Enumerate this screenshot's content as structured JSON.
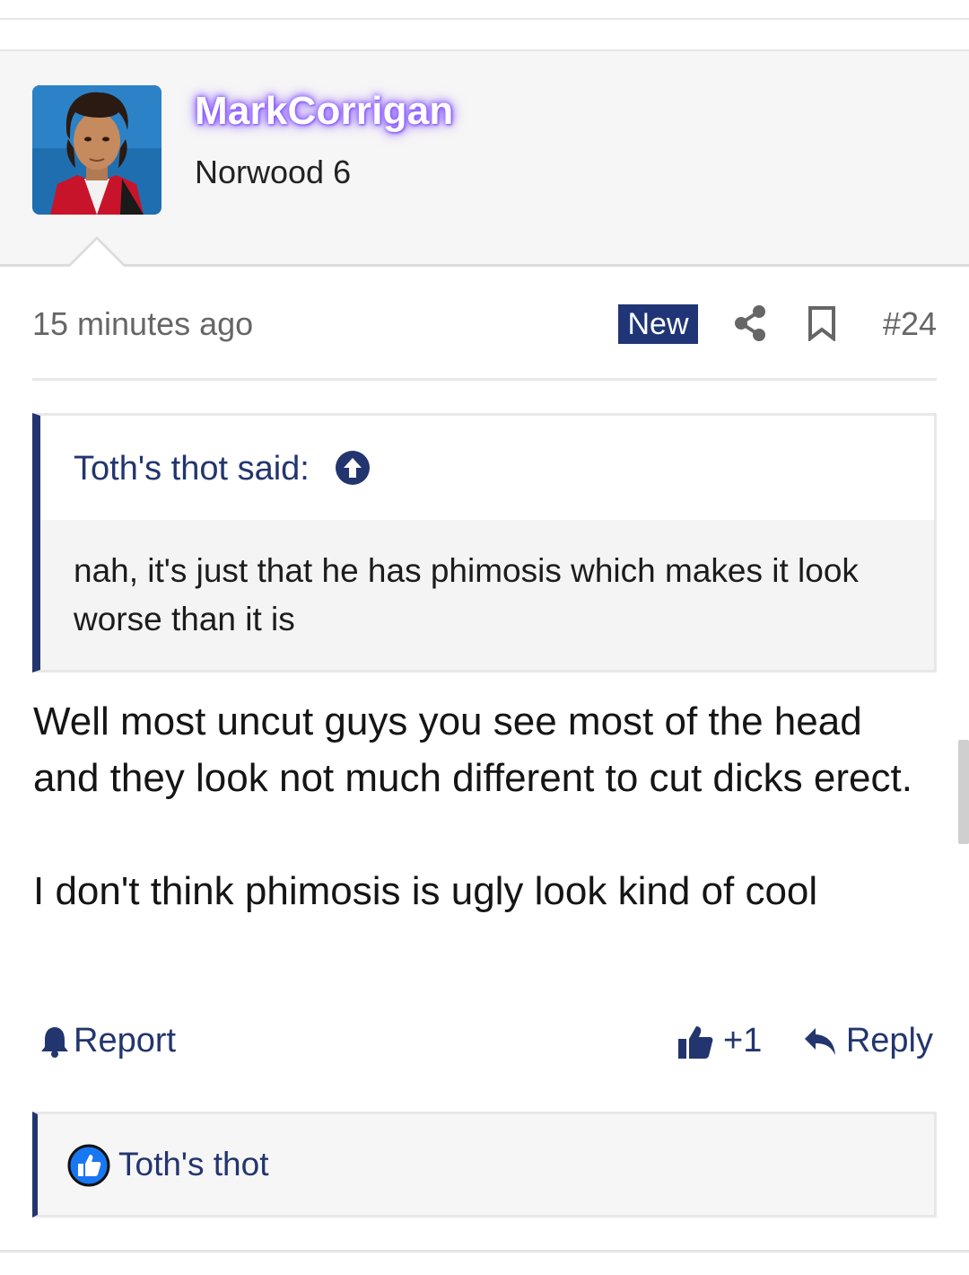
{
  "user": {
    "name": "MarkCorrigan",
    "title": "Norwood 6",
    "name_glow_color": "#8a5bff"
  },
  "meta": {
    "time": "15 minutes ago",
    "badge": "New",
    "post_number": "#24",
    "icons": [
      "share-icon",
      "bookmark-icon"
    ]
  },
  "quote": {
    "author_line": "Toth's thot said:",
    "text": "nah, it's just that he has phimosis which makes it look worse than it is",
    "icon": "arrow-up-circle-icon"
  },
  "body": {
    "paragraph_1": "Well most uncut guys you see most of the head and they look not much different to cut dicks erect.",
    "paragraph_2": "I don't think phimosis is ugly look kind of cool"
  },
  "actions": {
    "report_label": "Report",
    "like_count": "+1",
    "reply_label": "Reply"
  },
  "reactions": {
    "user": "Toth's thot",
    "icon": "like-reaction-icon"
  },
  "colors": {
    "accent": "#23356e",
    "badge_bg": "#1f3575",
    "like_blue": "#1877f2"
  }
}
